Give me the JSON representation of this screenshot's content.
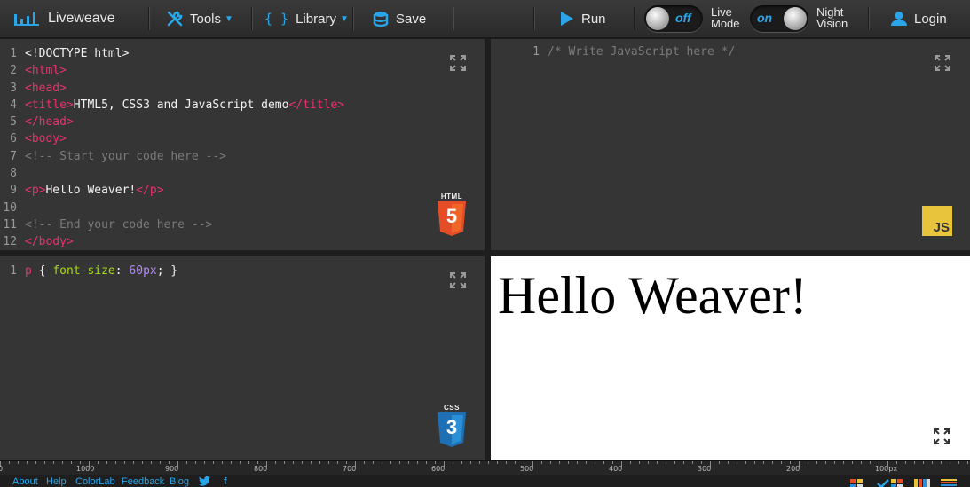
{
  "header": {
    "brand": "Liveweave",
    "tools_label": "Tools",
    "library_label": "Library",
    "save_label": "Save",
    "run_label": "Run",
    "live_mode": {
      "state": "off",
      "label_line1": "Live",
      "label_line2": "Mode"
    },
    "night_vision": {
      "state": "on",
      "label_line1": "Night",
      "label_line2": "Vision"
    },
    "login_label": "Login"
  },
  "html_editor": {
    "lines": [
      {
        "n": "1",
        "parts": [
          {
            "c": "txt",
            "t": "<!DOCTYPE html>"
          }
        ]
      },
      {
        "n": "2",
        "parts": [
          {
            "c": "tag",
            "t": "<html>"
          }
        ]
      },
      {
        "n": "3",
        "parts": [
          {
            "c": "tag",
            "t": "<head>"
          }
        ]
      },
      {
        "n": "4",
        "parts": [
          {
            "c": "tag",
            "t": "<title>"
          },
          {
            "c": "txt",
            "t": "HTML5, CSS3 and JavaScript demo"
          },
          {
            "c": "tag",
            "t": "</title>"
          }
        ]
      },
      {
        "n": "5",
        "parts": [
          {
            "c": "tag",
            "t": "</head>"
          }
        ]
      },
      {
        "n": "6",
        "parts": [
          {
            "c": "tag",
            "t": "<body>"
          }
        ]
      },
      {
        "n": "7",
        "parts": [
          {
            "c": "cmt",
            "t": "<!-- Start your code here -->"
          }
        ]
      },
      {
        "n": "8",
        "parts": []
      },
      {
        "n": "9",
        "parts": [
          {
            "c": "tag",
            "t": "<p>"
          },
          {
            "c": "txt",
            "t": "Hello Weaver!"
          },
          {
            "c": "tag",
            "t": "</p>"
          }
        ]
      },
      {
        "n": "10",
        "parts": []
      },
      {
        "n": "11",
        "parts": [
          {
            "c": "cmt",
            "t": "<!-- End your code here -->"
          }
        ]
      },
      {
        "n": "12",
        "parts": [
          {
            "c": "tag",
            "t": "</body>"
          }
        ]
      }
    ],
    "badge_label": "HTML",
    "badge_number": "5"
  },
  "js_editor": {
    "lines": [
      {
        "n": "1",
        "parts": [
          {
            "c": "cmt",
            "t": "/* Write JavaScript here */"
          }
        ]
      }
    ],
    "badge_label": "JS"
  },
  "css_editor": {
    "lines": [
      {
        "n": "1",
        "parts": [
          {
            "c": "tag",
            "t": "p"
          },
          {
            "c": "txt",
            "t": " { "
          },
          {
            "c": "prop",
            "t": "font-size"
          },
          {
            "c": "txt",
            "t": ": "
          },
          {
            "c": "num",
            "t": "60px"
          },
          {
            "c": "txt",
            "t": "; }"
          }
        ]
      }
    ],
    "badge_label": "CSS",
    "badge_number": "3"
  },
  "preview": {
    "text": "Hello Weaver!"
  },
  "ruler": {
    "labels": [
      "0",
      "1000",
      "900",
      "800",
      "700",
      "600",
      "500",
      "400",
      "300",
      "200",
      "100px"
    ]
  },
  "footer": {
    "links": [
      "About",
      "Help",
      "ColorLab",
      "Feedback",
      "Blog"
    ]
  },
  "colors": {
    "accent": "#2aa6e8",
    "tag": "#e8326c",
    "property": "#a6d91f",
    "number": "#b28cf0",
    "html5": "#e44d26",
    "css3": "#1f6fb5",
    "js": "#e8c43c"
  }
}
